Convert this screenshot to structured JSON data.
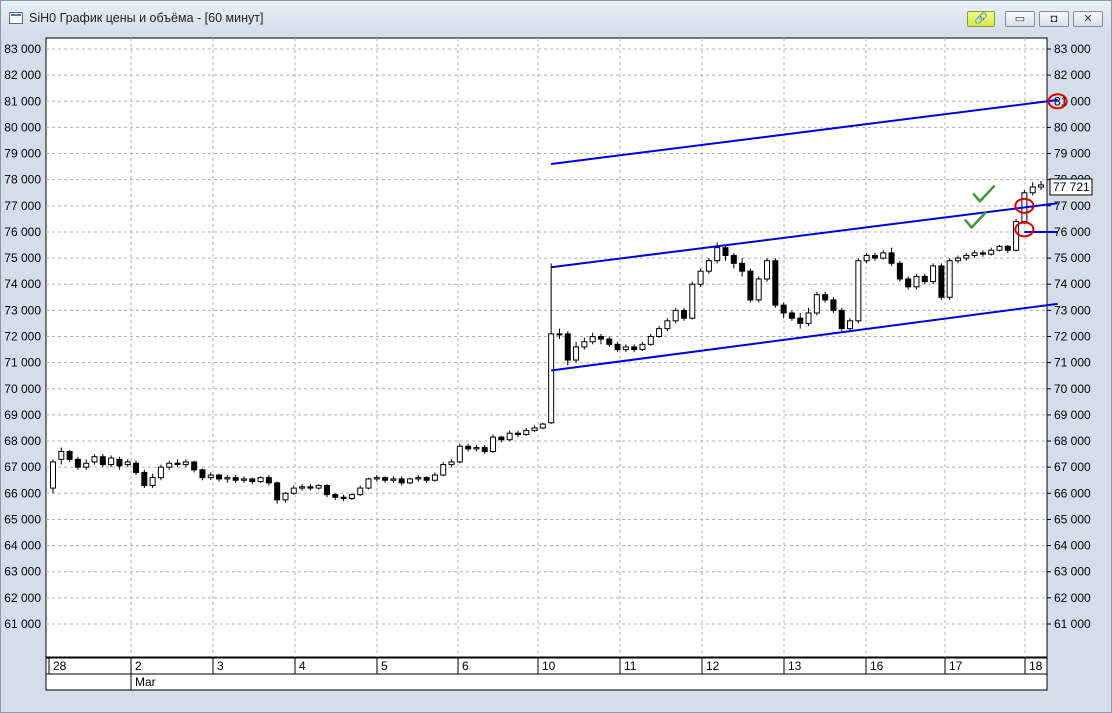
{
  "window": {
    "title": "SiH0 График цены и объёма - [60 минут]",
    "controls": {
      "link": "🔗",
      "minimize": "▭",
      "maximize": "◘",
      "close": "✕"
    }
  },
  "chart_data": {
    "type": "candlestick",
    "ylim": [
      60000,
      83500
    ],
    "yticks": [
      61000,
      62000,
      63000,
      64000,
      65000,
      66000,
      67000,
      68000,
      69000,
      70000,
      71000,
      72000,
      73000,
      74000,
      75000,
      76000,
      77000,
      78000,
      79000,
      80000,
      81000,
      82000,
      83000
    ],
    "ytick_labels": [
      "61 000",
      "62 000",
      "63 000",
      "64 000",
      "65 000",
      "66 000",
      "67 000",
      "68 000",
      "69 000",
      "70 000",
      "71 000",
      "72 000",
      "73 000",
      "74 000",
      "75 000",
      "76 000",
      "77 000",
      "78 000",
      "79 000",
      "80 000",
      "81 000",
      "82 000",
      "83 000"
    ],
    "left_ytick_labels": [
      "61 000",
      "62 000",
      "63 000",
      "64 000",
      "65 000",
      "66 000",
      "67 000",
      "68 000",
      "69 000",
      "70 000",
      "71 000",
      "72 000",
      "73 000",
      "74 000",
      "75 000",
      "76 000",
      "77 000",
      "78 000",
      "79 000",
      "80 000",
      "81 000",
      "82 000",
      "83 000"
    ],
    "day_labels": [
      "28",
      "2",
      "3",
      "4",
      "5",
      "6",
      "10",
      "11",
      "12",
      "13",
      "16",
      "17",
      "18"
    ],
    "month_label": "Mar",
    "current_price_label": "77 721",
    "current_price": 77721,
    "candles": [
      [
        66200,
        67200,
        66000,
        67300
      ],
      [
        67300,
        67600,
        67100,
        67750
      ],
      [
        67600,
        67300,
        67200,
        67650
      ],
      [
        67300,
        67000,
        66900,
        67400
      ],
      [
        67000,
        67150,
        66900,
        67300
      ],
      [
        67200,
        67400,
        67100,
        67500
      ],
      [
        67400,
        67100,
        67000,
        67500
      ],
      [
        67100,
        67350,
        67000,
        67450
      ],
      [
        67300,
        67050,
        66900,
        67400
      ],
      [
        67100,
        67200,
        67000,
        67300
      ],
      [
        67150,
        66800,
        66700,
        67250
      ],
      [
        66800,
        66300,
        66200,
        66900
      ],
      [
        66300,
        66600,
        66200,
        66750
      ],
      [
        66600,
        67000,
        66500,
        67100
      ],
      [
        67000,
        67150,
        66900,
        67250
      ],
      [
        67150,
        67100,
        67000,
        67300
      ],
      [
        67100,
        67200,
        67000,
        67300
      ],
      [
        67200,
        66900,
        66800,
        67250
      ],
      [
        66900,
        66600,
        66500,
        66950
      ],
      [
        66600,
        66700,
        66500,
        66800
      ],
      [
        66700,
        66550,
        66450,
        66750
      ],
      [
        66550,
        66600,
        66400,
        66700
      ],
      [
        66600,
        66500,
        66400,
        66700
      ],
      [
        66500,
        66550,
        66400,
        66650
      ],
      [
        66550,
        66450,
        66350,
        66600
      ],
      [
        66450,
        66600,
        66400,
        66650
      ],
      [
        66600,
        66400,
        66300,
        66700
      ],
      [
        66400,
        65750,
        65600,
        66450
      ],
      [
        65750,
        66000,
        65650,
        66050
      ],
      [
        66000,
        66200,
        65950,
        66300
      ],
      [
        66200,
        66250,
        66100,
        66350
      ],
      [
        66250,
        66200,
        66100,
        66350
      ],
      [
        66200,
        66300,
        66150,
        66350
      ],
      [
        66300,
        65950,
        65850,
        66350
      ],
      [
        65950,
        65850,
        65750,
        66000
      ],
      [
        65850,
        65800,
        65700,
        65950
      ],
      [
        65800,
        65950,
        65750,
        66000
      ],
      [
        65950,
        66200,
        65900,
        66300
      ],
      [
        66200,
        66550,
        66150,
        66600
      ],
      [
        66550,
        66600,
        66450,
        66700
      ],
      [
        66600,
        66500,
        66400,
        66650
      ],
      [
        66500,
        66550,
        66400,
        66650
      ],
      [
        66550,
        66400,
        66300,
        66650
      ],
      [
        66400,
        66550,
        66350,
        66600
      ],
      [
        66550,
        66600,
        66450,
        66700
      ],
      [
        66600,
        66500,
        66400,
        66650
      ],
      [
        66500,
        66700,
        66450,
        66800
      ],
      [
        66700,
        67100,
        66650,
        67200
      ],
      [
        67100,
        67200,
        67000,
        67300
      ],
      [
        67200,
        67800,
        67150,
        67900
      ],
      [
        67800,
        67700,
        67600,
        67900
      ],
      [
        67700,
        67750,
        67600,
        67850
      ],
      [
        67750,
        67600,
        67500,
        67850
      ],
      [
        67600,
        68150,
        67550,
        68250
      ],
      [
        68150,
        68050,
        67950,
        68200
      ],
      [
        68050,
        68300,
        68000,
        68400
      ],
      [
        68300,
        68250,
        68150,
        68400
      ],
      [
        68250,
        68400,
        68200,
        68500
      ],
      [
        68400,
        68500,
        68350,
        68600
      ],
      [
        68500,
        68650,
        68450,
        68700
      ],
      [
        68700,
        72100,
        68650,
        74800
      ],
      [
        72100,
        72100,
        71900,
        72300
      ],
      [
        72100,
        71100,
        70900,
        72200
      ],
      [
        71100,
        71600,
        71000,
        71800
      ],
      [
        71600,
        71800,
        71500,
        71950
      ],
      [
        71800,
        72000,
        71700,
        72150
      ],
      [
        72000,
        71900,
        71700,
        72100
      ],
      [
        71900,
        71700,
        71600,
        72000
      ],
      [
        71700,
        71500,
        71400,
        71800
      ],
      [
        71500,
        71600,
        71400,
        71700
      ],
      [
        71600,
        71500,
        71400,
        71700
      ],
      [
        71500,
        71700,
        71450,
        71800
      ],
      [
        71700,
        72000,
        71650,
        72100
      ],
      [
        72000,
        72300,
        71950,
        72400
      ],
      [
        72300,
        72600,
        72200,
        72700
      ],
      [
        72600,
        73000,
        72500,
        73100
      ],
      [
        73000,
        72700,
        72600,
        73100
      ],
      [
        72700,
        74000,
        72650,
        74100
      ],
      [
        74000,
        74500,
        73900,
        74600
      ],
      [
        74500,
        74900,
        74400,
        75000
      ],
      [
        74900,
        75400,
        74800,
        75600
      ],
      [
        75400,
        75100,
        74900,
        75500
      ],
      [
        75100,
        74800,
        74600,
        75200
      ],
      [
        74800,
        74500,
        74300,
        75000
      ],
      [
        74500,
        73400,
        73300,
        74600
      ],
      [
        73400,
        74200,
        73300,
        74300
      ],
      [
        74200,
        74900,
        74100,
        75000
      ],
      [
        74900,
        73200,
        73100,
        75000
      ],
      [
        73200,
        72900,
        72700,
        73300
      ],
      [
        72900,
        72700,
        72600,
        73000
      ],
      [
        72700,
        72500,
        72300,
        72900
      ],
      [
        72500,
        72900,
        72400,
        73100
      ],
      [
        72900,
        73600,
        72800,
        73700
      ],
      [
        73600,
        73400,
        73300,
        73700
      ],
      [
        73400,
        73000,
        72900,
        73500
      ],
      [
        73000,
        72300,
        72200,
        73100
      ],
      [
        72300,
        72600,
        72200,
        72700
      ],
      [
        72600,
        74900,
        72500,
        75000
      ],
      [
        74900,
        75100,
        74800,
        75200
      ],
      [
        75100,
        75000,
        74900,
        75200
      ],
      [
        75000,
        75200,
        74950,
        75300
      ],
      [
        75200,
        74800,
        74700,
        75400
      ],
      [
        74800,
        74200,
        74100,
        74900
      ],
      [
        74200,
        73900,
        73800,
        74300
      ],
      [
        73900,
        74300,
        73800,
        74400
      ],
      [
        74300,
        74100,
        74000,
        74400
      ],
      [
        74100,
        74700,
        74000,
        74800
      ],
      [
        74700,
        73500,
        73400,
        74800
      ],
      [
        73500,
        74900,
        73400,
        75000
      ],
      [
        74900,
        75000,
        74800,
        75100
      ],
      [
        75000,
        75100,
        74900,
        75200
      ],
      [
        75100,
        75200,
        75000,
        75300
      ],
      [
        75200,
        75150,
        75050,
        75300
      ],
      [
        75150,
        75300,
        75100,
        75400
      ],
      [
        75300,
        75450,
        75250,
        75500
      ],
      [
        75450,
        75300,
        75200,
        75500
      ],
      [
        75300,
        76400,
        75250,
        76500
      ],
      [
        76400,
        77500,
        76300,
        77600
      ],
      [
        77500,
        77721,
        77400,
        77900
      ],
      [
        77721,
        77800,
        77600,
        77950
      ]
    ],
    "trendlines": [
      {
        "points": [
          [
            60,
            78600
          ],
          [
            121,
            81050
          ]
        ],
        "color": "#0000dd"
      },
      {
        "points": [
          [
            60,
            74650
          ],
          [
            121,
            77100
          ]
        ],
        "color": "#0000dd"
      },
      {
        "points": [
          [
            60,
            70700
          ],
          [
            121,
            73250
          ]
        ],
        "color": "#0000dd"
      },
      {
        "points": [
          [
            117,
            76000
          ],
          [
            121,
            76000
          ]
        ],
        "color": "#0000dd"
      }
    ],
    "markers": [
      {
        "type": "circle",
        "x": 121,
        "y": 81000,
        "color": "#dd0000"
      },
      {
        "type": "circle",
        "x": 117,
        "y": 77000,
        "color": "#dd0000"
      },
      {
        "type": "circle",
        "x": 117,
        "y": 76100,
        "color": "#dd0000"
      },
      {
        "type": "check",
        "x": 112,
        "y": 77400,
        "color": "#3a9a3a"
      },
      {
        "type": "check",
        "x": 111,
        "y": 76400,
        "color": "#3a9a3a"
      }
    ],
    "grid": true
  }
}
